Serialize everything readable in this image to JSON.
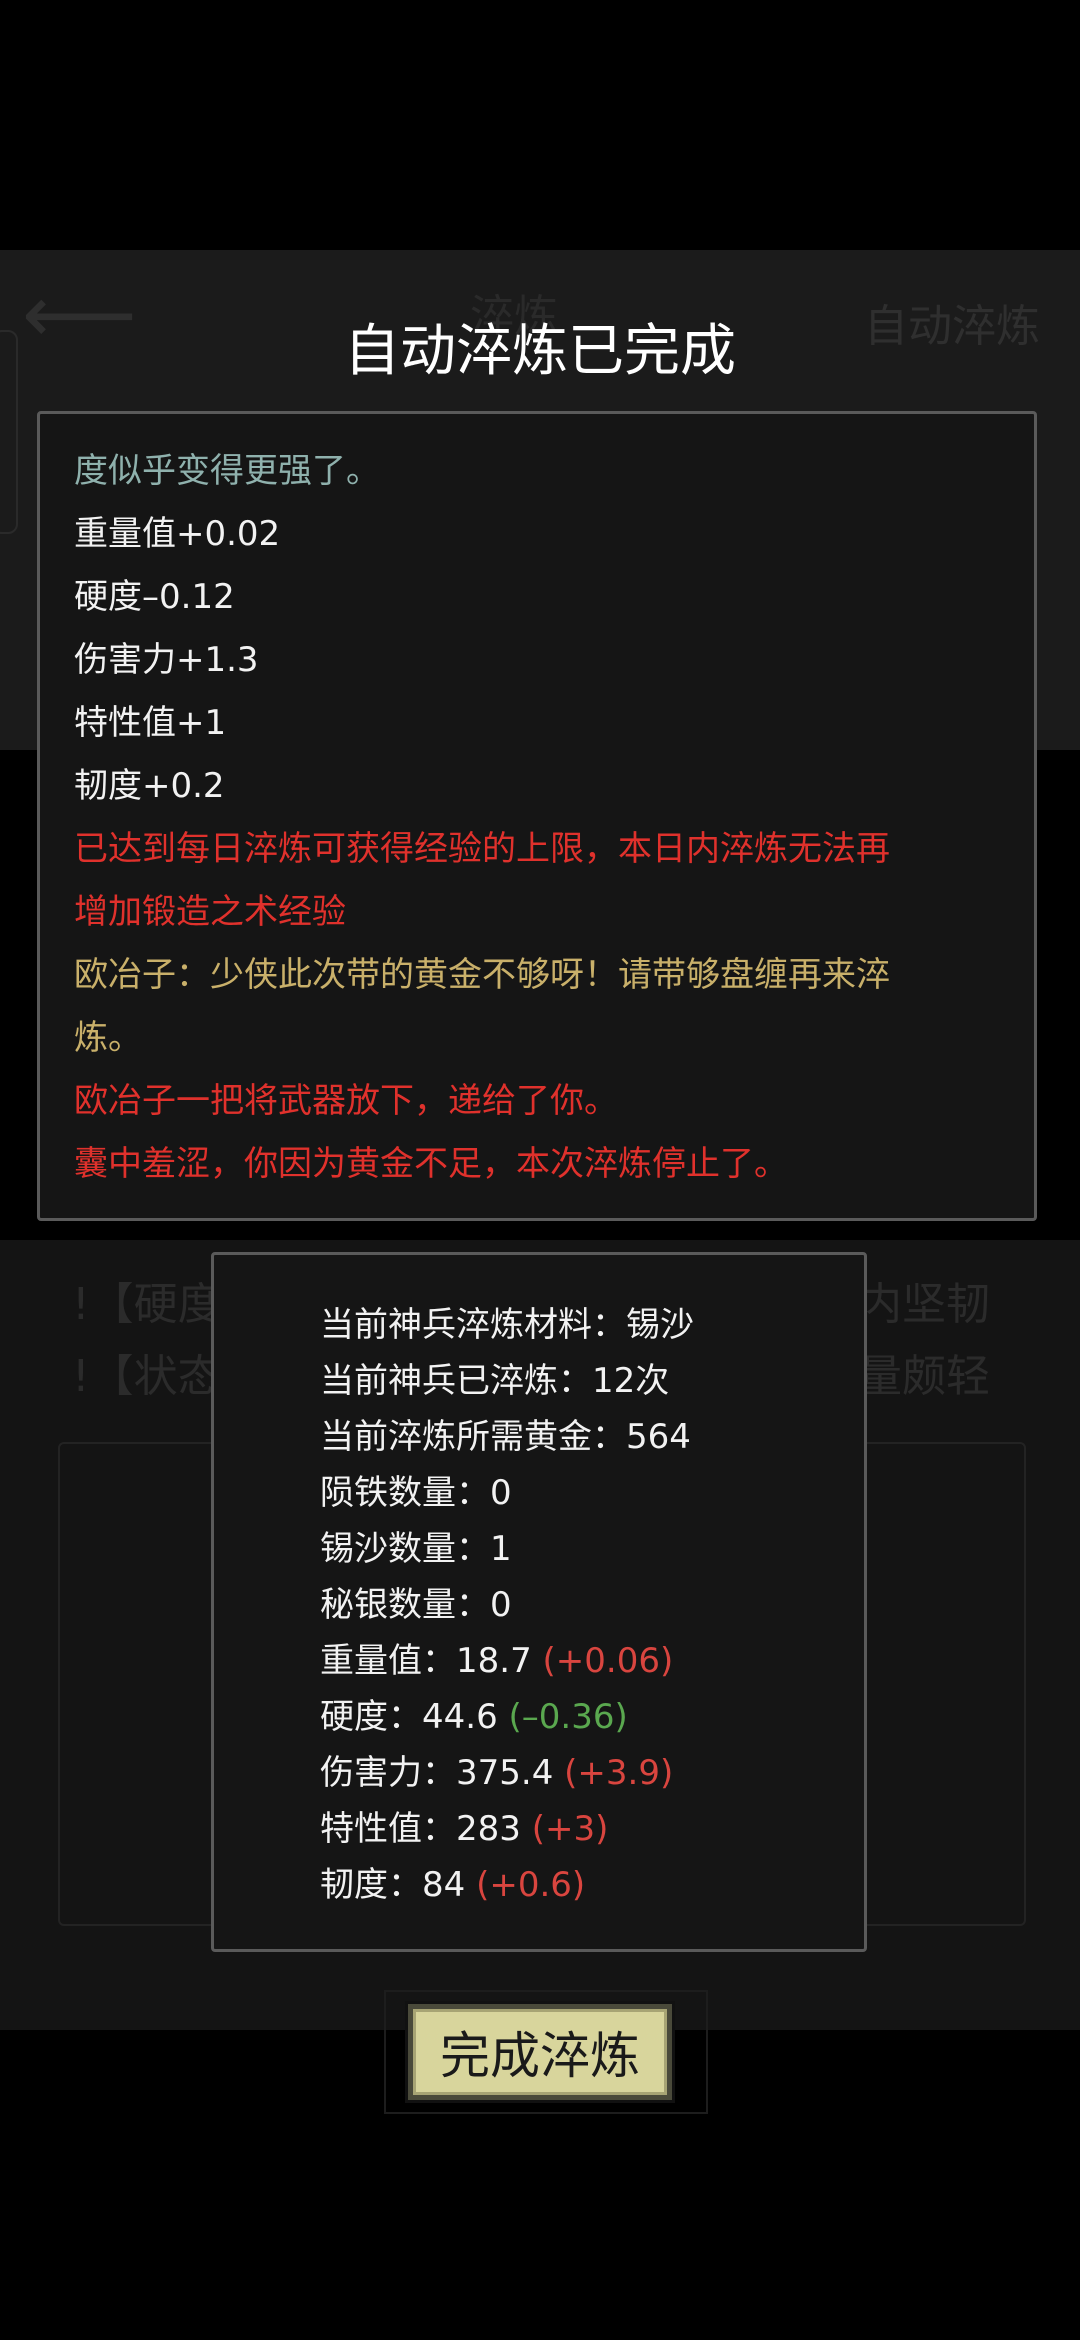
{
  "title": "自动淬炼已完成",
  "log_lines": [
    {
      "text": "度似乎变得更强了。",
      "color": "#8fb1ad"
    },
    {
      "text": "重量值+0.02",
      "color": "#f2f2f2"
    },
    {
      "text": "硬度–0.12",
      "color": "#f2f2f2"
    },
    {
      "text": "伤害力+1.3",
      "color": "#f2f2f2"
    },
    {
      "text": "特性值+1",
      "color": "#f2f2f2"
    },
    {
      "text": "韧度+0.2",
      "color": "#f2f2f2"
    },
    {
      "text": "已达到每日淬炼可获得经验的上限，本日内淬炼无法再",
      "color": "#e0312c"
    },
    {
      "text": "增加锻造之术经验",
      "color": "#e0312c"
    },
    {
      "text": "欧冶子：少侠此次带的黄金不够呀！请带够盘缠再来淬",
      "color": "#c9b06a"
    },
    {
      "text": "炼。",
      "color": "#c9b06a"
    },
    {
      "text": "欧冶子一把将武器放下，递给了你。",
      "color": "#e0312c"
    },
    {
      "text": "囊中羞涩，你因为黄金不足，本次淬炼停止了。",
      "color": "#e0312c"
    }
  ],
  "stats": {
    "material": "当前神兵淬炼材料：锡沙",
    "refined_count": "当前神兵已淬炼：12次",
    "gold_needed": "当前淬炼所需黄金：564",
    "meteor_iron": "陨铁数量：0",
    "tin_sand": "锡沙数量：1",
    "mithril": "秘银数量：0",
    "weight_label": "重量值：18.7",
    "weight_delta": "(+0.06)",
    "hardness_label": "硬度：44.6",
    "hardness_delta": "(–0.36)",
    "damage_label": "伤害力：375.4",
    "damage_delta": "(+3.9)",
    "trait_label": "特性值：283",
    "trait_delta": "(+3)",
    "toughness_label": "韧度：84",
    "toughness_delta": "(+0.6)"
  },
  "done_button": "完成淬炼",
  "background": {
    "header_center": "淬炼",
    "header_right": "自动淬炼",
    "row1_left": "!【硬度",
    "row1_right": "内坚韧",
    "row2_left": "!【状态",
    "row2_right": "量颇轻"
  }
}
